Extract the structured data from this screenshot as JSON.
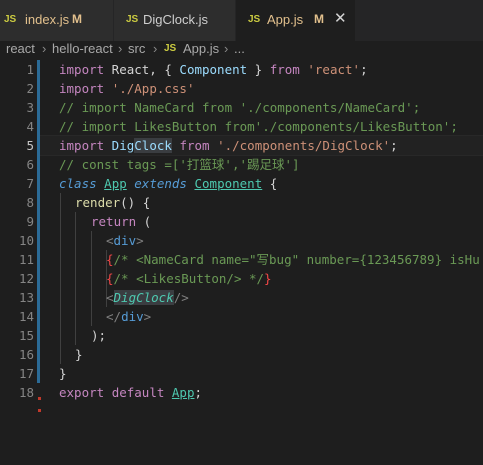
{
  "tabs": [
    {
      "icon": "JS",
      "label": "index.js",
      "badge": "M"
    },
    {
      "icon": "JS",
      "label": "DigClock.js",
      "badge": ""
    },
    {
      "icon": "JS",
      "label": "App.js",
      "badge": "M",
      "close": "✕"
    }
  ],
  "breadcrumb": [
    "react",
    "hello-react",
    "src",
    "App.js",
    "..."
  ],
  "breadcrumb_icon": "JS",
  "line_numbers": [
    "1",
    "2",
    "3",
    "4",
    "5",
    "6",
    "7",
    "8",
    "9",
    "10",
    "11",
    "12",
    "13",
    "14",
    "15",
    "16",
    "17",
    "18"
  ],
  "code": {
    "l1": {
      "a": "import",
      "b": " React, { ",
      "c": "Component",
      "d": " } ",
      "e": "from",
      "f": " ",
      "g": "'react'",
      "h": ";"
    },
    "l2": {
      "a": "import",
      "b": " ",
      "c": "'./App.css'"
    },
    "l3": "// import NameCard from './components/NameCard';",
    "l4": "// import LikesButton from'./components/LikesButton';",
    "l5": {
      "a": "import",
      "b": " Dig",
      "c": "Clock",
      "d": " ",
      "e": "from",
      "f": " ",
      "g": "'./components/DigClock'",
      "h": ";"
    },
    "l6": "// const tags =['打篮球','踢足球']",
    "l7": {
      "a": "class",
      "b": " ",
      "c": "App",
      "d": " ",
      "e": "extends",
      "f": " ",
      "g": "Component",
      "h": " {"
    },
    "l8": {
      "a": "render",
      "b": "() {"
    },
    "l9": {
      "a": "return",
      "b": " ("
    },
    "l10": {
      "a": "<",
      "b": "div",
      "c": ">"
    },
    "l11": {
      "a": "{",
      "b": "/* <NameCard name=\"写bug\" number={123456789} isHu",
      "c": ""
    },
    "l12": {
      "a": "{",
      "b": "/* <LikesButton/> */",
      "c": "}"
    },
    "l13": {
      "a": "<",
      "b": "DigClock",
      "c": "/>"
    },
    "l14": {
      "a": "</",
      "b": "div",
      "c": ">"
    },
    "l15": ");",
    "l16": "}",
    "l17": "}",
    "l18": {
      "a": "export",
      "b": " ",
      "c": "default",
      "d": " ",
      "e": "App",
      "f": ";"
    }
  }
}
